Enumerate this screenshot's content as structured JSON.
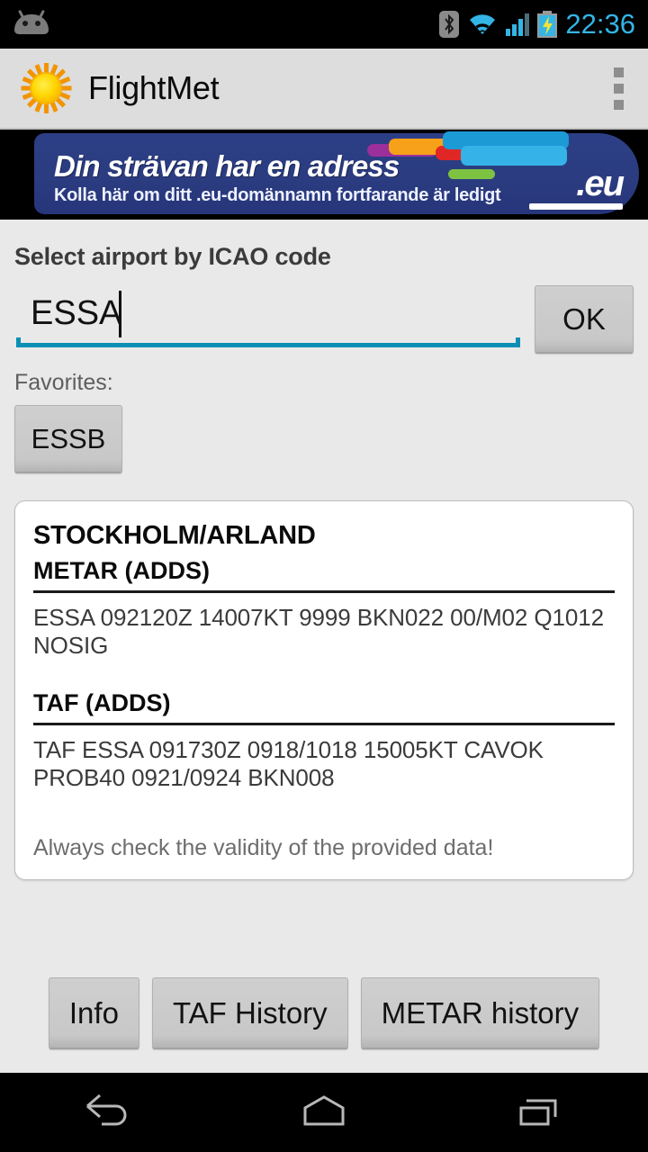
{
  "status_bar": {
    "notification_icon": "android-robot-icon",
    "icons": [
      "bluetooth-icon",
      "wifi-icon",
      "cellular-signal-icon",
      "battery-charging-icon"
    ],
    "time": "22:36",
    "accent_color": "#33b5e5"
  },
  "action_bar": {
    "logo_icon": "sun-icon",
    "title": "FlightMet",
    "overflow_icon": "overflow-menu-icon"
  },
  "ad": {
    "headline": "Din strävan har en adress",
    "subline": "Kolla här om ditt .eu-domännamn fortfarande är ledigt",
    "logo_text": ".eu",
    "background_color": "#2b3c80"
  },
  "form": {
    "label": "Select airport by ICAO code",
    "input_value": "ESSA",
    "input_placeholder": "ICAO",
    "underline_color": "#0b8fb5",
    "ok_label": "OK"
  },
  "favorites": {
    "label": "Favorites:",
    "items": [
      {
        "label": "ESSB"
      }
    ]
  },
  "weather_card": {
    "station": "STOCKHOLM/ARLAND",
    "metar_heading": "METAR (ADDS)",
    "metar_text": "ESSA 092120Z 14007KT 9999 BKN022 00/M02 Q1012 NOSIG",
    "taf_heading": "TAF (ADDS)",
    "taf_text": "TAF ESSA 091730Z 0918/1018 15005KT CAVOK PROB40 0921/0924 BKN008",
    "note": "Always check the validity of the provided data!"
  },
  "bottom_buttons": [
    {
      "label": "Info"
    },
    {
      "label": "TAF History"
    },
    {
      "label": "METAR history"
    }
  ],
  "nav_bar": {
    "back_icon": "back-icon",
    "home_icon": "home-icon",
    "recents_icon": "recents-icon"
  }
}
